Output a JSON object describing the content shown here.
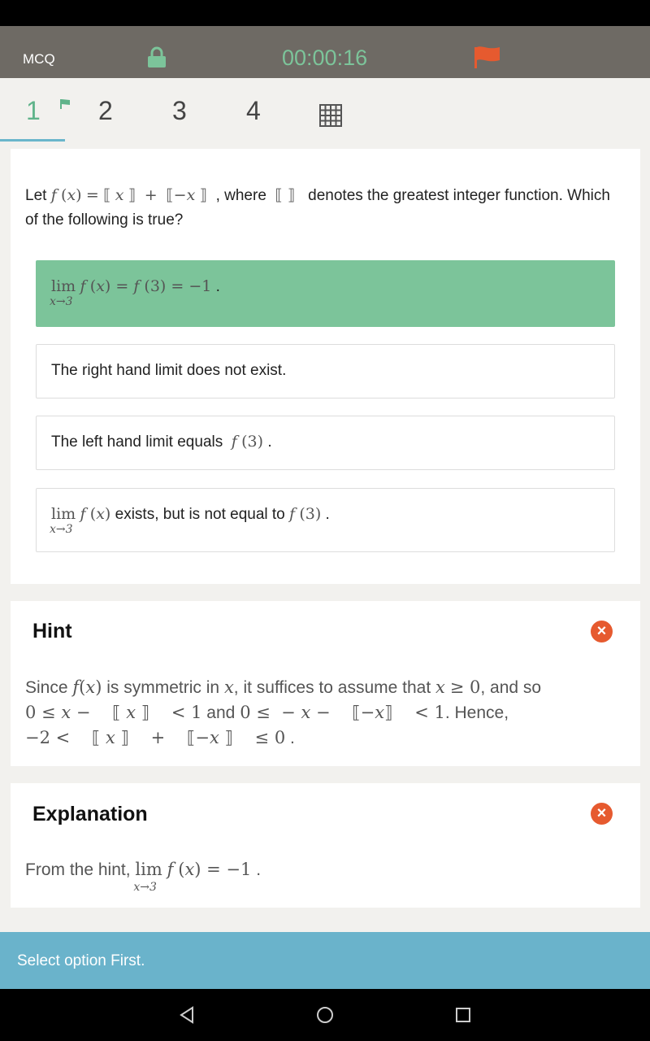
{
  "header": {
    "mode": "MCQ",
    "timer": "00:00:16"
  },
  "tabs": [
    "1",
    "2",
    "3",
    "4"
  ],
  "question": {
    "prefix": "Let",
    "middle": ", where",
    "suffix": "denotes the greatest integer function. Which of the following is true?"
  },
  "options": {
    "opt1": "lim f (x) = f (3) = −1 .",
    "opt2": "The right hand limit does not exist.",
    "opt3_text": "The left hand limit equals",
    "opt3_math": "f (3) .",
    "opt4_text": "exists, but is not equal to",
    "opt4_math": "f (3) ."
  },
  "hint": {
    "title": "Hint",
    "t1": "Since",
    "t2": "is symmetric in",
    "t3": ", it suffices to assume that",
    "t4": ", and so",
    "t5": "and",
    "t6": ". Hence,"
  },
  "explanation": {
    "title": "Explanation",
    "text": "From the hint,"
  },
  "footer": {
    "message": "Select option First."
  },
  "colors": {
    "accent_green": "#7cc49a",
    "accent_blue": "#6ab3cb",
    "flag_orange": "#e65a2f"
  }
}
